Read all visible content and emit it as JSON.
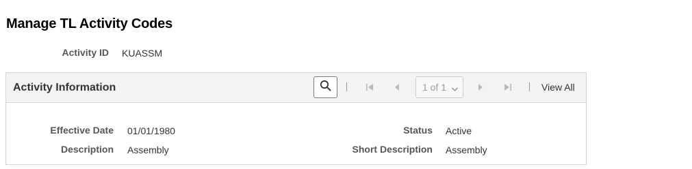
{
  "page": {
    "title": "Manage TL Activity Codes"
  },
  "activity": {
    "id_label": "Activity ID",
    "id_value": "KUASSM"
  },
  "section": {
    "title": "Activity Information",
    "pager": {
      "selected": "1 of 1",
      "view_all_label": "View All"
    },
    "fields": {
      "effective_date_label": "Effective Date",
      "effective_date_value": "01/01/1980",
      "description_label": "Description",
      "description_value": "Assembly",
      "status_label": "Status",
      "status_value": "Active",
      "short_description_label": "Short Description",
      "short_description_value": "Assembly"
    }
  },
  "icons": {
    "search": "search-icon",
    "first": "first-page-icon",
    "previous": "previous-icon",
    "next": "next-icon",
    "last": "last-page-icon",
    "dropdown": "chevron-down-icon"
  },
  "colors": {
    "header_bg": "#f3f3f3",
    "border": "#d4d4d4",
    "disabled_icon": "#b8b8b8"
  }
}
